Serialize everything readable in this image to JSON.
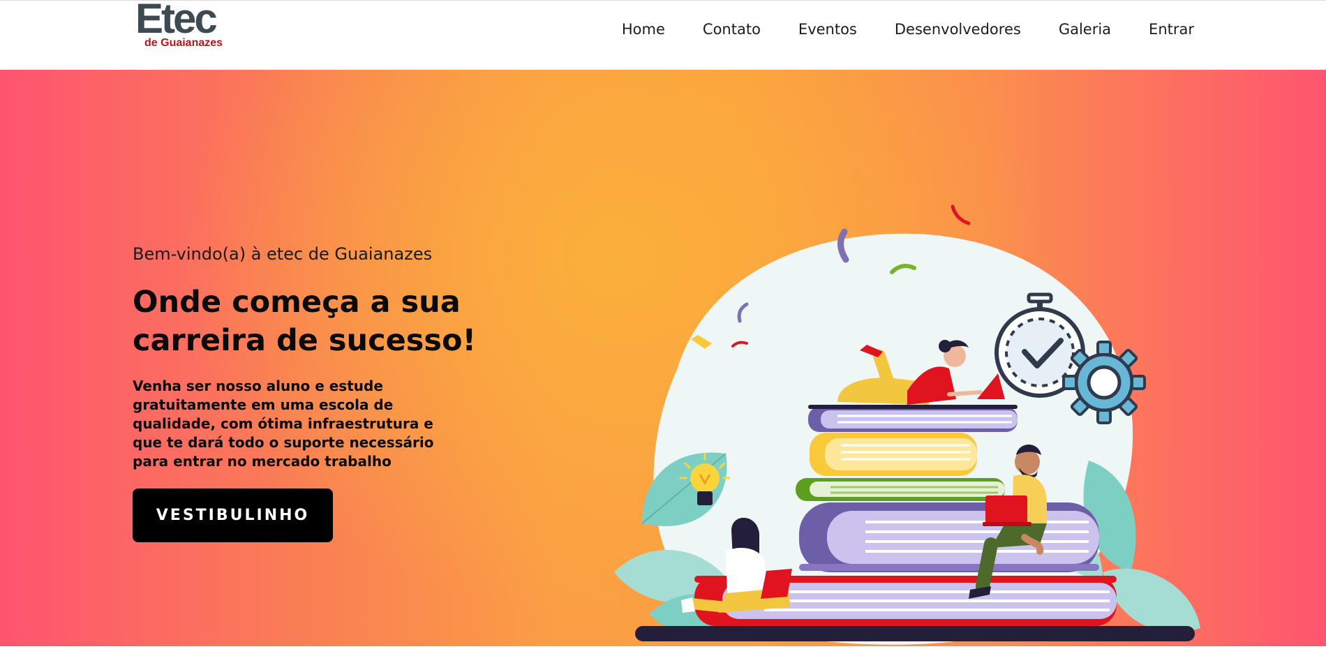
{
  "header": {
    "logo": {
      "title": "Etec",
      "subtitle": "de Guaianazes"
    },
    "nav": [
      {
        "label": "Home"
      },
      {
        "label": "Contato"
      },
      {
        "label": "Eventos"
      },
      {
        "label": "Desenvolvedores"
      },
      {
        "label": "Galeria"
      },
      {
        "label": "Entrar"
      }
    ]
  },
  "hero": {
    "greeting": "Bem-vindo(a) à etec de Guaianazes",
    "title_lines": [
      "Onde começa a sua",
      "carreira de sucesso!"
    ],
    "text_lines": [
      "Venha ser nosso aluno e estude",
      "gratuitamente em uma escola de",
      "qualidade, com ótima infraestrutura e",
      "que te dará todo o suporte necessário",
      "para entrar no mercado trabalho"
    ],
    "cta_label": "VESTIBULINHO"
  },
  "illustration": {
    "icons": [
      "stopwatch-check-icon",
      "gear-icon",
      "lightbulb-icon"
    ]
  },
  "colors": {
    "gradient_edge": "#fe5470",
    "gradient_center": "#fbb03b",
    "logo_gray": "#3e4a52",
    "logo_red": "#c0121b",
    "button": "#000000"
  }
}
